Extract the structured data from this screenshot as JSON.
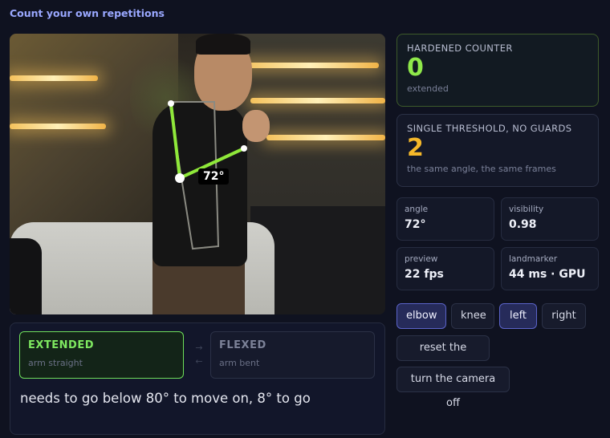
{
  "app": {
    "title": "Count your own repetitions"
  },
  "camera": {
    "angle_label": "72°"
  },
  "states": {
    "extended": {
      "label": "EXTENDED",
      "sub": "arm straight",
      "active": true
    },
    "flexed": {
      "label": "FLEXED",
      "sub": "arm bent",
      "active": false
    },
    "arrow_right": "→",
    "arrow_left": "←",
    "message": "needs to go below 80° to move on, 8° to go"
  },
  "counters": {
    "hardened": {
      "title": "HARDENED COUNTER",
      "value": "0",
      "sub": "extended"
    },
    "single": {
      "title": "SINGLE THRESHOLD, NO GUARDS",
      "value": "2",
      "sub": "the same angle, the same frames"
    }
  },
  "stats": {
    "angle": {
      "label": "angle",
      "value": "72°"
    },
    "visibility": {
      "label": "visibility",
      "value": "0.98"
    },
    "preview": {
      "label": "preview",
      "value": "22 fps"
    },
    "landmarker": {
      "label": "landmarker",
      "value": "44 ms · GPU"
    }
  },
  "controls": {
    "elbow": "elbow",
    "knee": "knee",
    "left": "left",
    "right": "right",
    "reset": "reset the count",
    "camera_off": "turn the camera off",
    "selected": [
      "elbow",
      "left"
    ]
  },
  "colors": {
    "accent": "#9aa8ff",
    "extended_green": "#7ee860",
    "hardened_value": "#8fe84a",
    "single_value": "#f5b82a",
    "skeleton": "#8fe83a"
  }
}
